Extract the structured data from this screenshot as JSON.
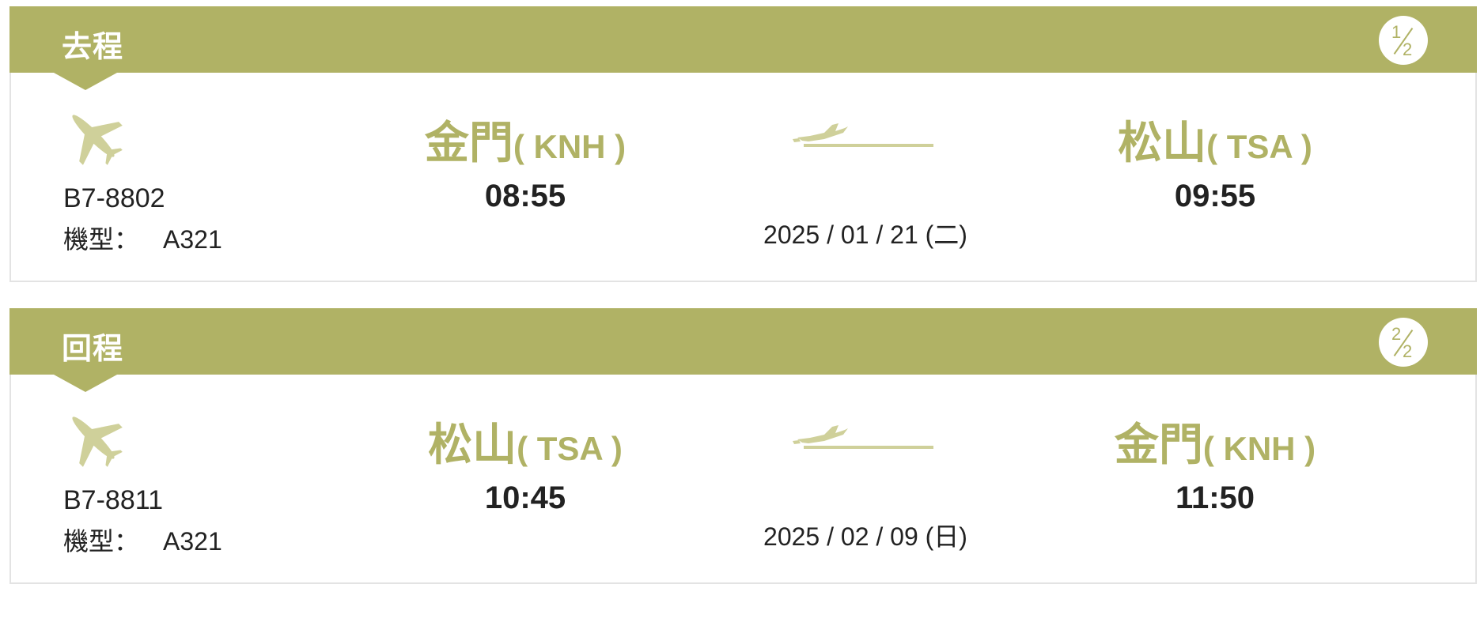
{
  "segments": [
    {
      "title": "去程",
      "badge": {
        "num": "1",
        "den": "2"
      },
      "flight_no": "B7-8802",
      "aircraft_label": "機型：",
      "aircraft_type": "A321",
      "departure": {
        "city": "金門",
        "code": "( KNH )",
        "time": "08:55"
      },
      "arrival": {
        "city": "松山",
        "code": "( TSA )",
        "time": "09:55"
      },
      "date": "2025 / 01 / 21 (二)"
    },
    {
      "title": "回程",
      "badge": {
        "num": "2",
        "den": "2"
      },
      "flight_no": "B7-8811",
      "aircraft_label": "機型：",
      "aircraft_type": "A321",
      "departure": {
        "city": "松山",
        "code": "( TSA )",
        "time": "10:45"
      },
      "arrival": {
        "city": "金門",
        "code": "( KNH )",
        "time": "11:50"
      },
      "date": "2025 / 02 / 09 (日)"
    }
  ],
  "icons": {
    "segment_plane": "airplane-icon",
    "route": "takeoff-icon"
  },
  "colors": {
    "accent": "#b0b265",
    "accent_light": "#cfd09a",
    "text": "#222222"
  }
}
